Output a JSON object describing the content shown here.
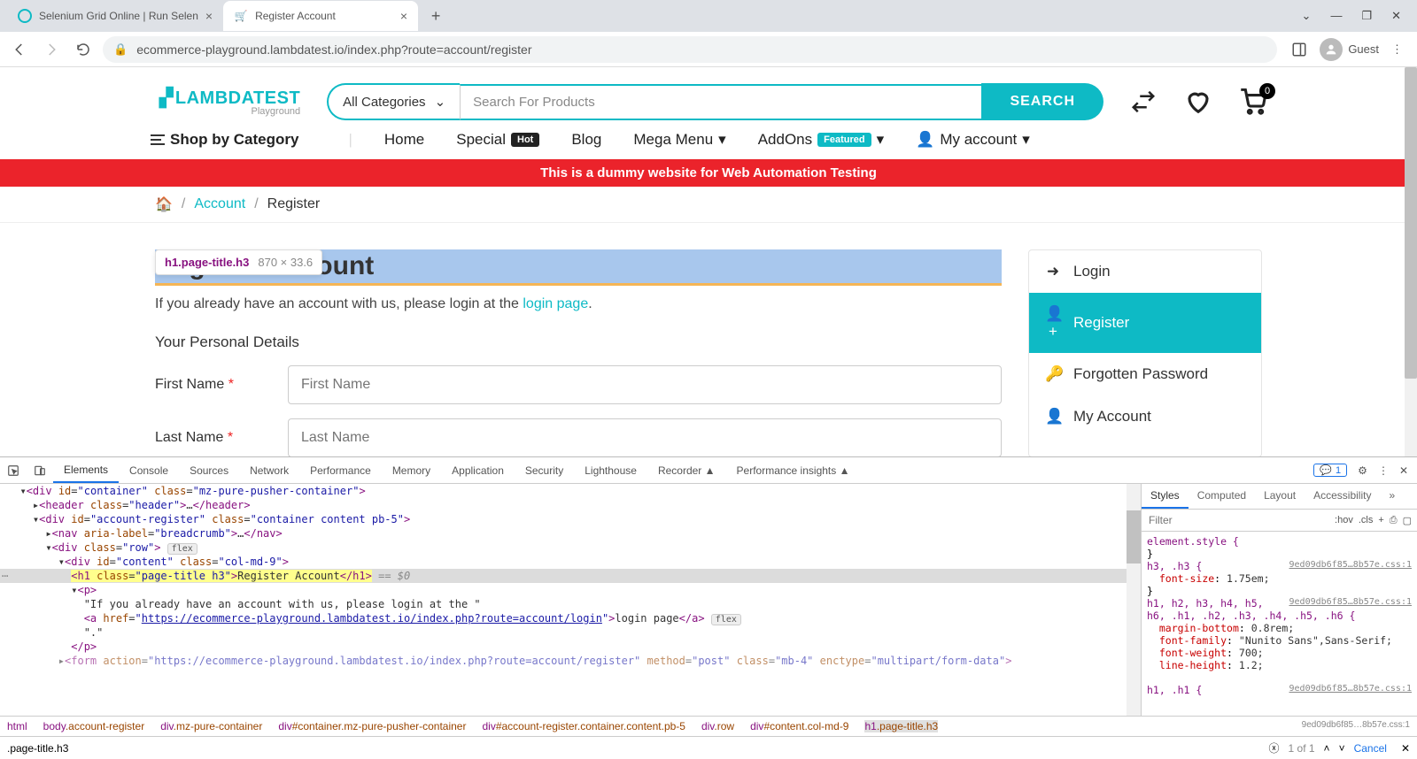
{
  "browser": {
    "tabs": [
      {
        "title": "Selenium Grid Online | Run Selen",
        "active": false
      },
      {
        "title": "Register Account",
        "active": true
      }
    ],
    "new_tab": "+",
    "minimize": "—",
    "maximize": "❐",
    "close": "✕",
    "chevron": "⌄",
    "url": "ecommerce-playground.lambdatest.io/index.php?route=account/register",
    "guest": "Guest"
  },
  "site": {
    "logo_main": "LAMBDATEST",
    "logo_sub": "Playground",
    "category_dropdown": "All Categories",
    "search_placeholder": "Search For Products",
    "search_button": "SEARCH",
    "cart_count": "0",
    "nav": {
      "shop": "Shop by Category",
      "home": "Home",
      "special": "Special",
      "special_badge": "Hot",
      "blog": "Blog",
      "mega": "Mega Menu",
      "addons": "AddOns",
      "addons_badge": "Featured",
      "account": "My account"
    },
    "banner": "This is a dummy website for Web Automation Testing",
    "breadcrumb": {
      "account": "Account",
      "register": "Register"
    },
    "inspect_tooltip": {
      "selector": "h1.page-title.h3",
      "dimensions": "870 × 33.6"
    },
    "h1": "Register Account",
    "intro_text": "If you already have an account with us, please login at the ",
    "intro_link": "login page",
    "intro_dot": ".",
    "fieldset": "Your Personal Details",
    "first_name_label": "First Name",
    "first_name_placeholder": "First Name",
    "last_name_label": "Last Name",
    "last_name_placeholder": "Last Name",
    "sidebar": {
      "login": "Login",
      "register": "Register",
      "forgotten": "Forgotten Password",
      "my_account": "My Account"
    }
  },
  "devtools": {
    "tabs": [
      "Elements",
      "Console",
      "Sources",
      "Network",
      "Performance",
      "Memory",
      "Application",
      "Security",
      "Lighthouse",
      "Recorder ▲",
      "Performance insights ▲"
    ],
    "active_tab": "Elements",
    "issue_count": "1",
    "html_lines": {
      "l1": "<div id=\"container\" class=\"mz-pure-pusher-container\">",
      "l2": "  <header class=\"header\">…</header>",
      "l3": "  <div id=\"account-register\" class=\"container content pb-5\">",
      "l4": "    <nav aria-label=\"breadcrumb\">…</nav>",
      "l5a": "    <div class=\"row\">",
      "l5b": " flex",
      "l6": "      <div id=\"content\" class=\"col-md-9\">",
      "l7_open": "<h1 class=\"page-title h3\">",
      "l7_text": "Register Account",
      "l7_close": "</h1>",
      "l7_after": " == $0",
      "l8": "        <p>",
      "l9": "          \"If you already have an account with us, please login at the \"",
      "l10_pre": "          <a href=\"",
      "l10_url": "https://ecommerce-playground.lambdatest.io/index.php?route=account/login",
      "l10_mid": "\">login page</a>",
      "l10_flex": " flex",
      "l11": "          \".\"",
      "l12": "        </p>",
      "l13": "      <form action=\"https://ecommerce-playground.lambdatest.io/index.php?route=account/register\" method=\"post\" class=\"mb-4\" enctype=\"multipart/form-data\">"
    },
    "crumbs": [
      {
        "tag": "html",
        "rest": ""
      },
      {
        "tag": "body",
        "rest": ".account-register"
      },
      {
        "tag": "div",
        "rest": ".mz-pure-container"
      },
      {
        "tag": "div",
        "rest": "#container.mz-pure-pusher-container"
      },
      {
        "tag": "div",
        "rest": "#account-register.container.content.pb-5"
      },
      {
        "tag": "div",
        "rest": ".row"
      },
      {
        "tag": "div",
        "rest": "#content.col-md-9"
      },
      {
        "tag": "h1",
        "rest": ".page-title.h3"
      }
    ],
    "search_value": ".page-title.h3",
    "search_count": "1 of 1",
    "search_cancel": "Cancel",
    "styles": {
      "tabs": [
        "Styles",
        "Computed",
        "Layout",
        "Accessibility"
      ],
      "filter_placeholder": "Filter",
      "hov": ":hov",
      "cls": ".cls",
      "src": "9ed09db6f85…8b57e.css:1",
      "rules": {
        "r1": "element.style {",
        "r1c": "}",
        "r2": "h3, .h3 {",
        "r2p1k": "font-size",
        "r2p1v": "1.75em;",
        "r2c": "}",
        "r3a": "h1, h2, h3, h4, h5,",
        "r3b": "h6, .h1, .h2, .h3, .h4, .h5, .h6 {",
        "r3p1k": "margin-bottom",
        "r3p1v": "0.8rem;",
        "r3p2k": "font-family",
        "r3p2v": "\"Nunito Sans\",Sans-Serif;",
        "r3p3k": "font-weight",
        "r3p3v": "700;",
        "r3p4k": "line-height",
        "r3p4v": "1.2;",
        "r4": "h1, .h1 {"
      }
    }
  }
}
